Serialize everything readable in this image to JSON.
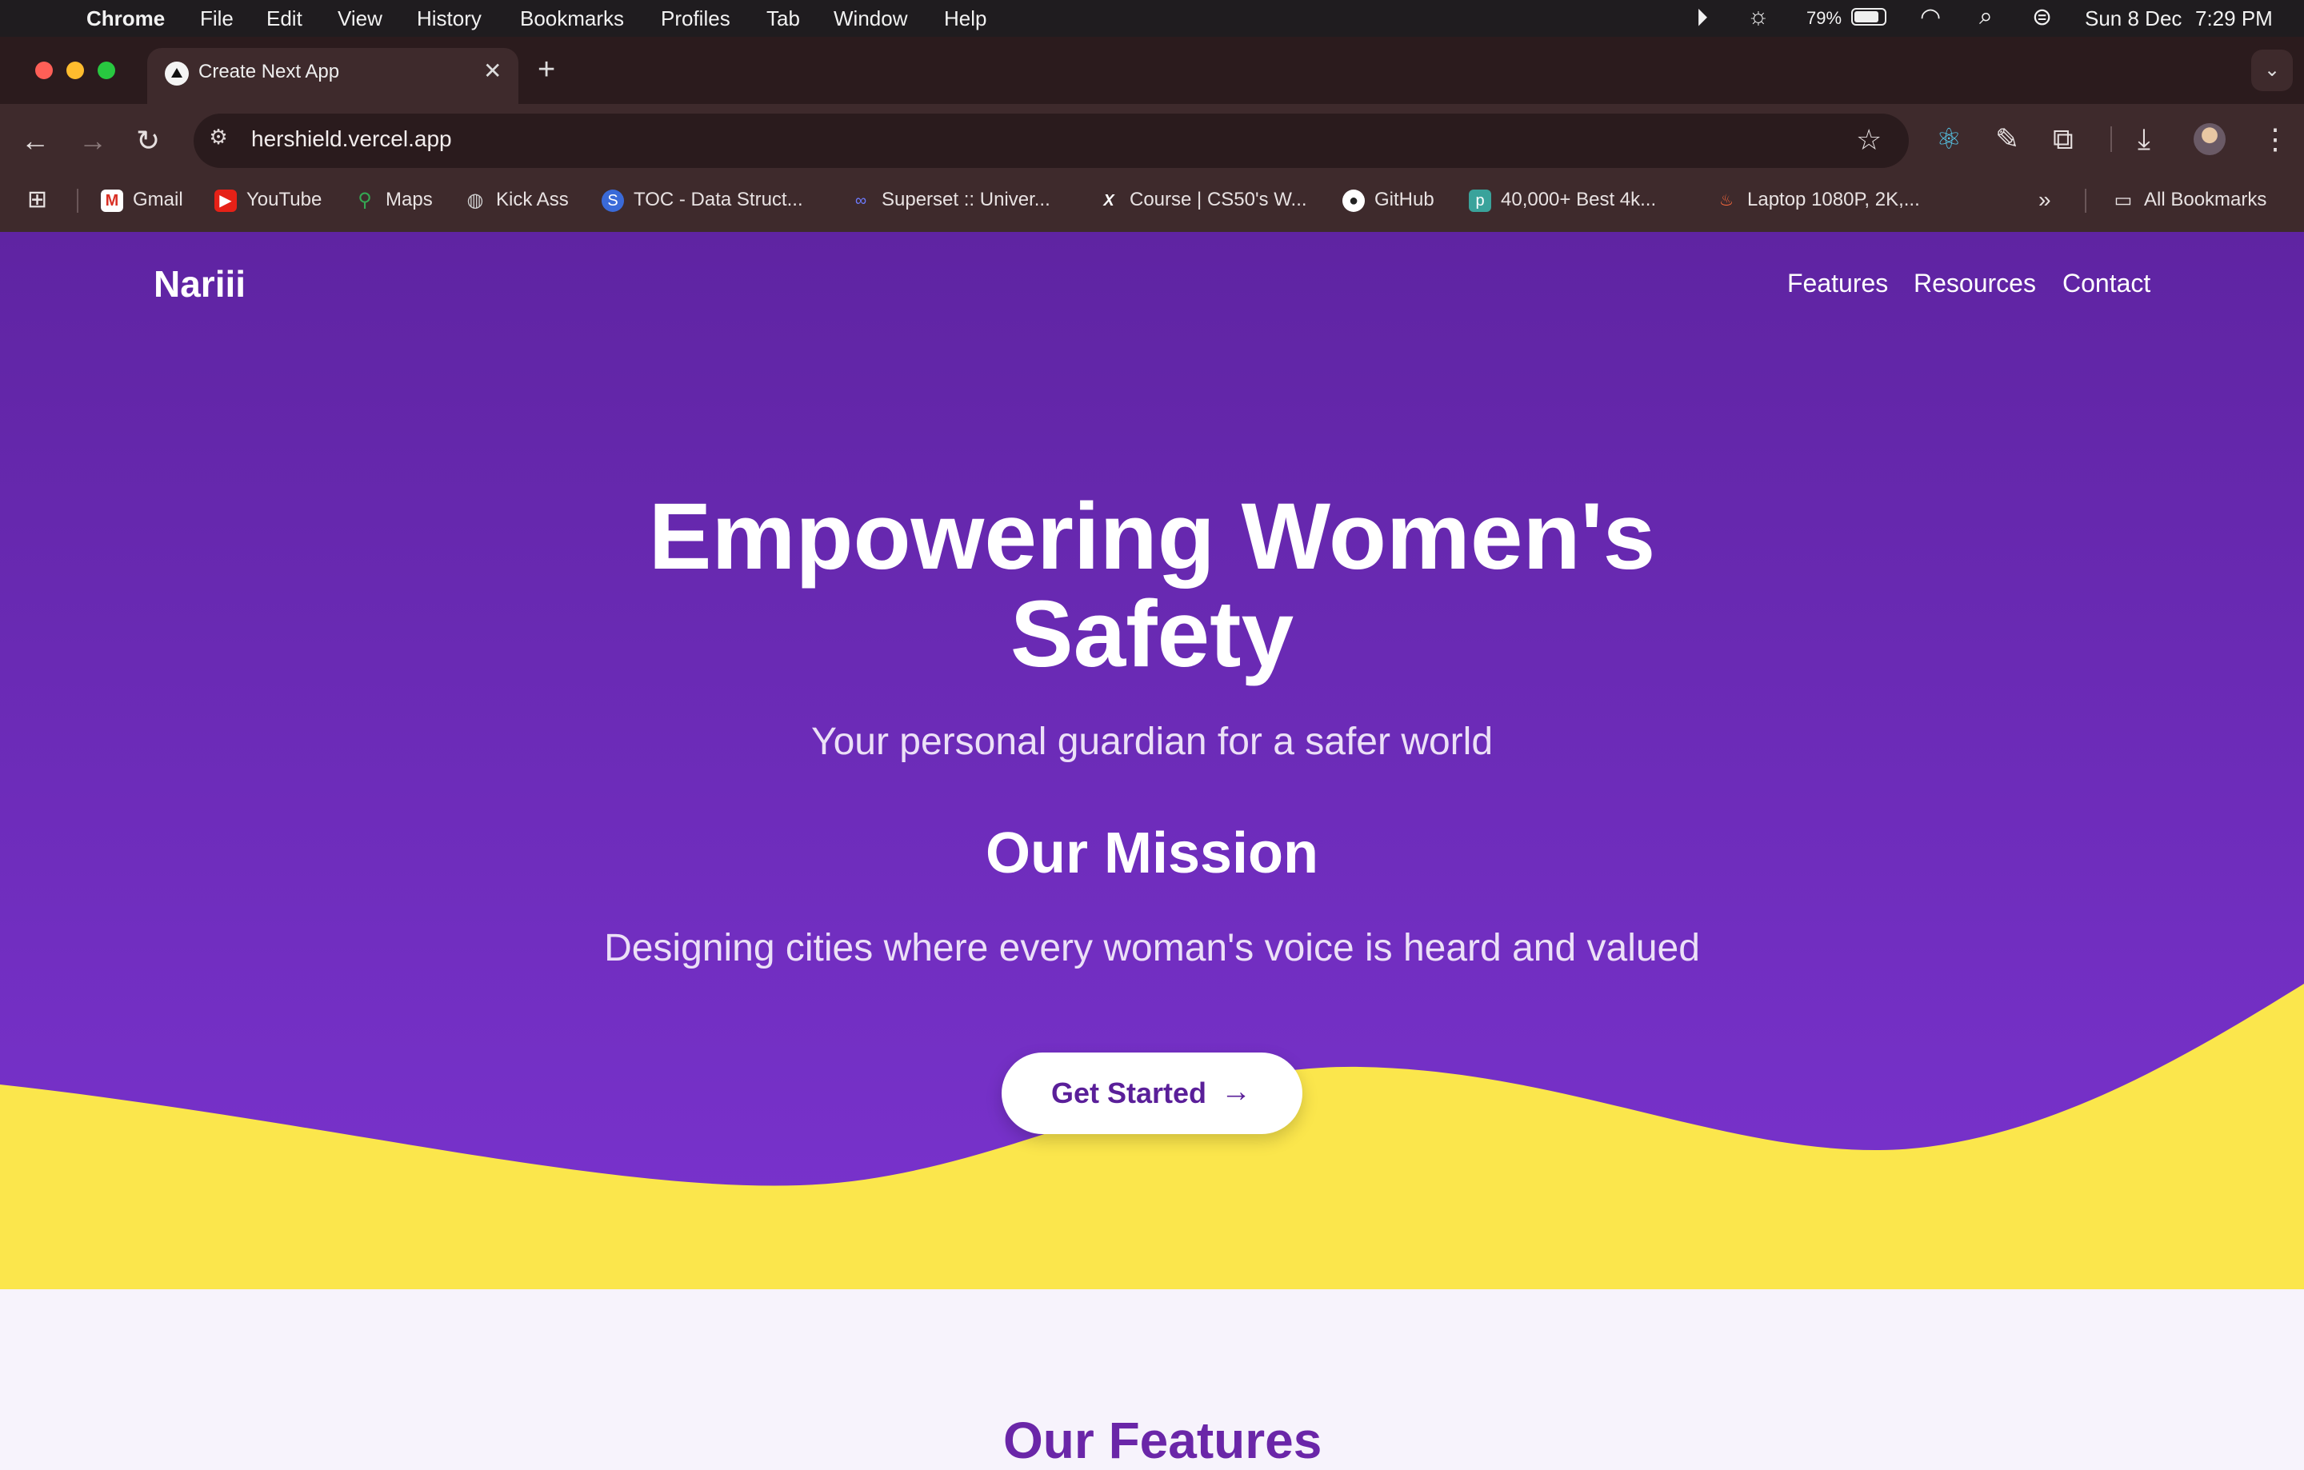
{
  "menubar": {
    "app": "Chrome",
    "items": [
      "File",
      "Edit",
      "View",
      "History",
      "Bookmarks",
      "Profiles",
      "Tab",
      "Window",
      "Help"
    ],
    "battery": "79%",
    "date": "Sun 8 Dec",
    "time": "7:29 PM"
  },
  "tab": {
    "title": "Create Next App"
  },
  "toolbar": {
    "url": "hershield.vercel.app"
  },
  "bookmarks": {
    "items": [
      "Gmail",
      "YouTube",
      "Maps",
      "Kick Ass",
      "TOC - Data Struct...",
      "Superset :: Univer...",
      "Course | CS50's W...",
      "GitHub",
      "40,000+ Best 4k...",
      "Laptop 1080P, 2K,..."
    ],
    "all": "All Bookmarks"
  },
  "page": {
    "logo": "Nariii",
    "nav": [
      "Features",
      "Resources",
      "Contact"
    ],
    "headline_line1": "Empowering Women's",
    "headline_line2": "Safety",
    "tagline": "Your personal guardian for a safer world",
    "mission_title": "Our Mission",
    "mission_text": "Designing cities where every woman's voice is heard and valued",
    "cta": "Get Started",
    "features_title": "Our Features"
  },
  "colors": {
    "hero_top": "#5f24a2",
    "hero_bottom": "#7a33cf",
    "wave": "#fbe64c",
    "cta_text": "#5a1f99",
    "page_bg": "#f7f3fc"
  }
}
